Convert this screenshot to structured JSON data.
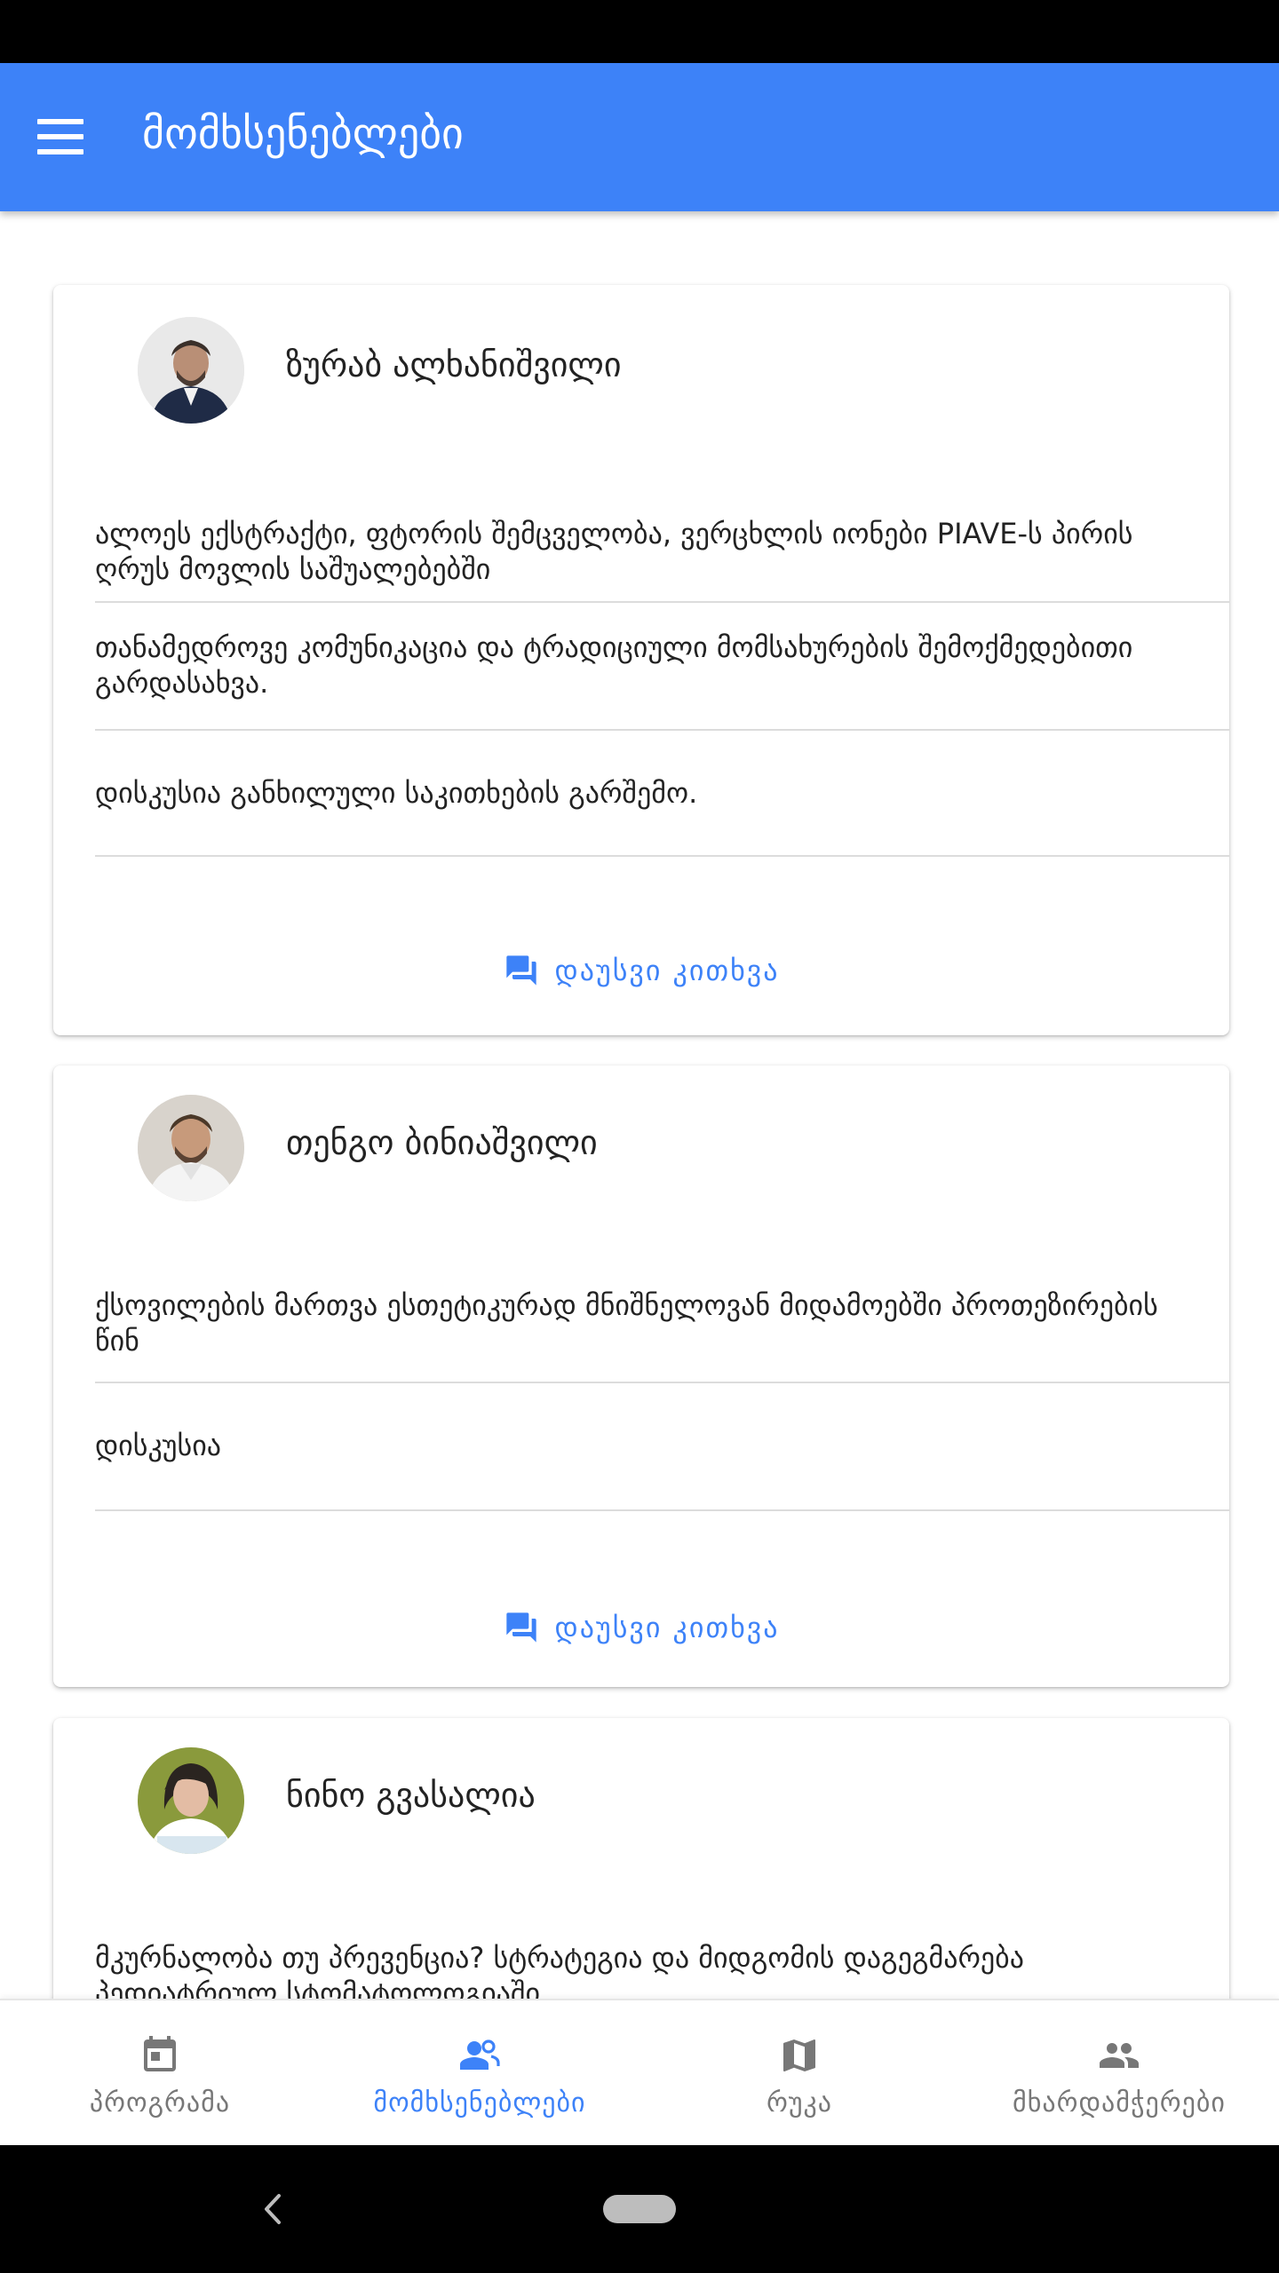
{
  "app_bar": {
    "title": "მომხსენებლები"
  },
  "speakers": [
    {
      "name": "ზურაბ ალხანიშვილი",
      "topics": [
        "ალოეს ექსტრაქტი, ფტორის შემცველობა, ვერცხლის იონები PIAVE-ს პირის ღრუს მოვლის საშუალებებში",
        "თანამედროვე კომუნიკაცია და ტრადიციული მომსახურების შემოქმედებითი გარდასახვა.",
        "დისკუსია განხილული საკითხების გარშემო."
      ],
      "ask_label": "დაუსვი კითხვა"
    },
    {
      "name": "თენგო ბინიაშვილი",
      "topics": [
        "ქსოვილების მართვა ესთეტიკურად მნიშნელოვან მიდამოებში პროთეზირების წინ",
        "დისკუსია"
      ],
      "ask_label": "დაუსვი კითხვა"
    },
    {
      "name": "ნინო გვასალია",
      "topics": [
        "მკურნალობა თუ პრევენცია? სტრატეგია და მიდგომის დაგეგმარება პედიატრიულ სტომატოლოგიაში"
      ]
    }
  ],
  "bottom_nav": [
    {
      "label": "პროგრამა",
      "icon": "calendar-icon",
      "active": false
    },
    {
      "label": "მომხსენებლები",
      "icon": "speakers-icon",
      "active": true
    },
    {
      "label": "რუკა",
      "icon": "map-icon",
      "active": false
    },
    {
      "label": "მხარდამჭერები",
      "icon": "people-icon",
      "active": false
    }
  ],
  "colors": {
    "primary": "#3d82f8",
    "inactive": "#777777"
  }
}
